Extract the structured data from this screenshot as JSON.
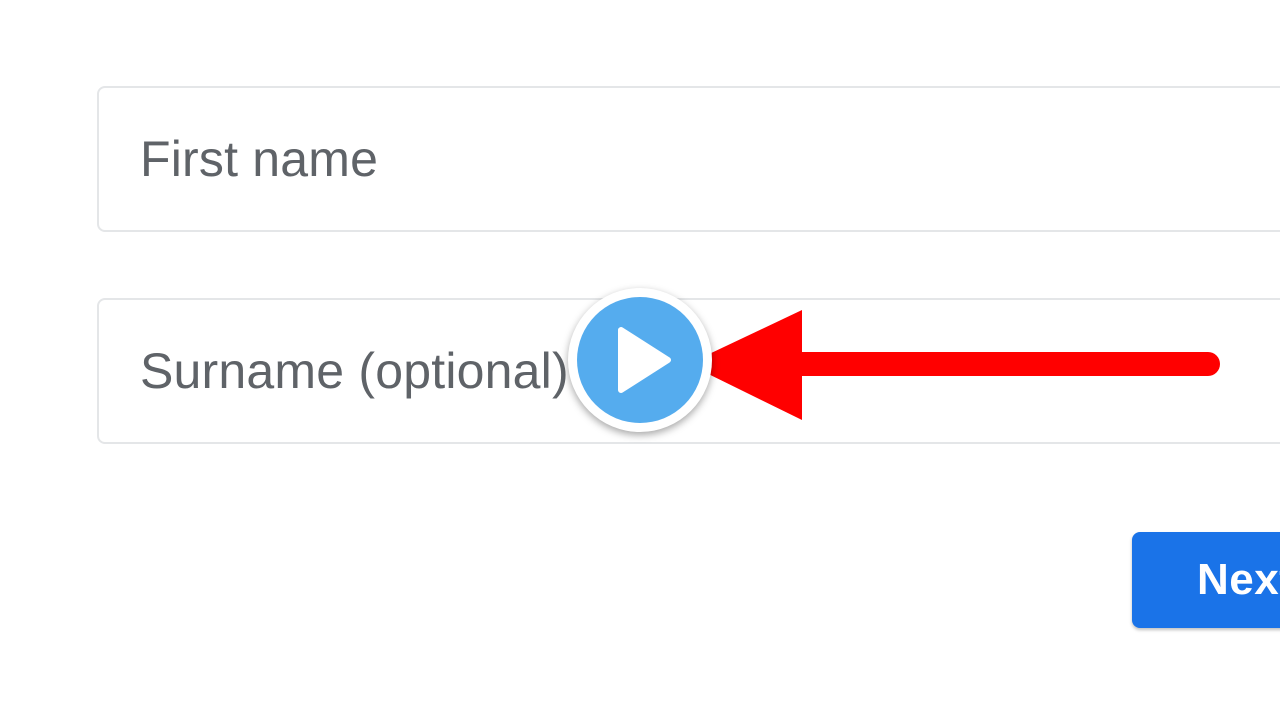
{
  "form": {
    "first_name_placeholder": "First name",
    "surname_placeholder": "Surname (optional)",
    "next_label": "Next"
  },
  "overlay": {
    "play_icon": "play-icon",
    "arrow_icon": "arrow-left-icon",
    "arrow_color": "#ff0000",
    "play_color": "#55acee"
  },
  "colors": {
    "button": "#1a73e8",
    "placeholder": "#5f6368",
    "border": "#e4e6e8"
  }
}
